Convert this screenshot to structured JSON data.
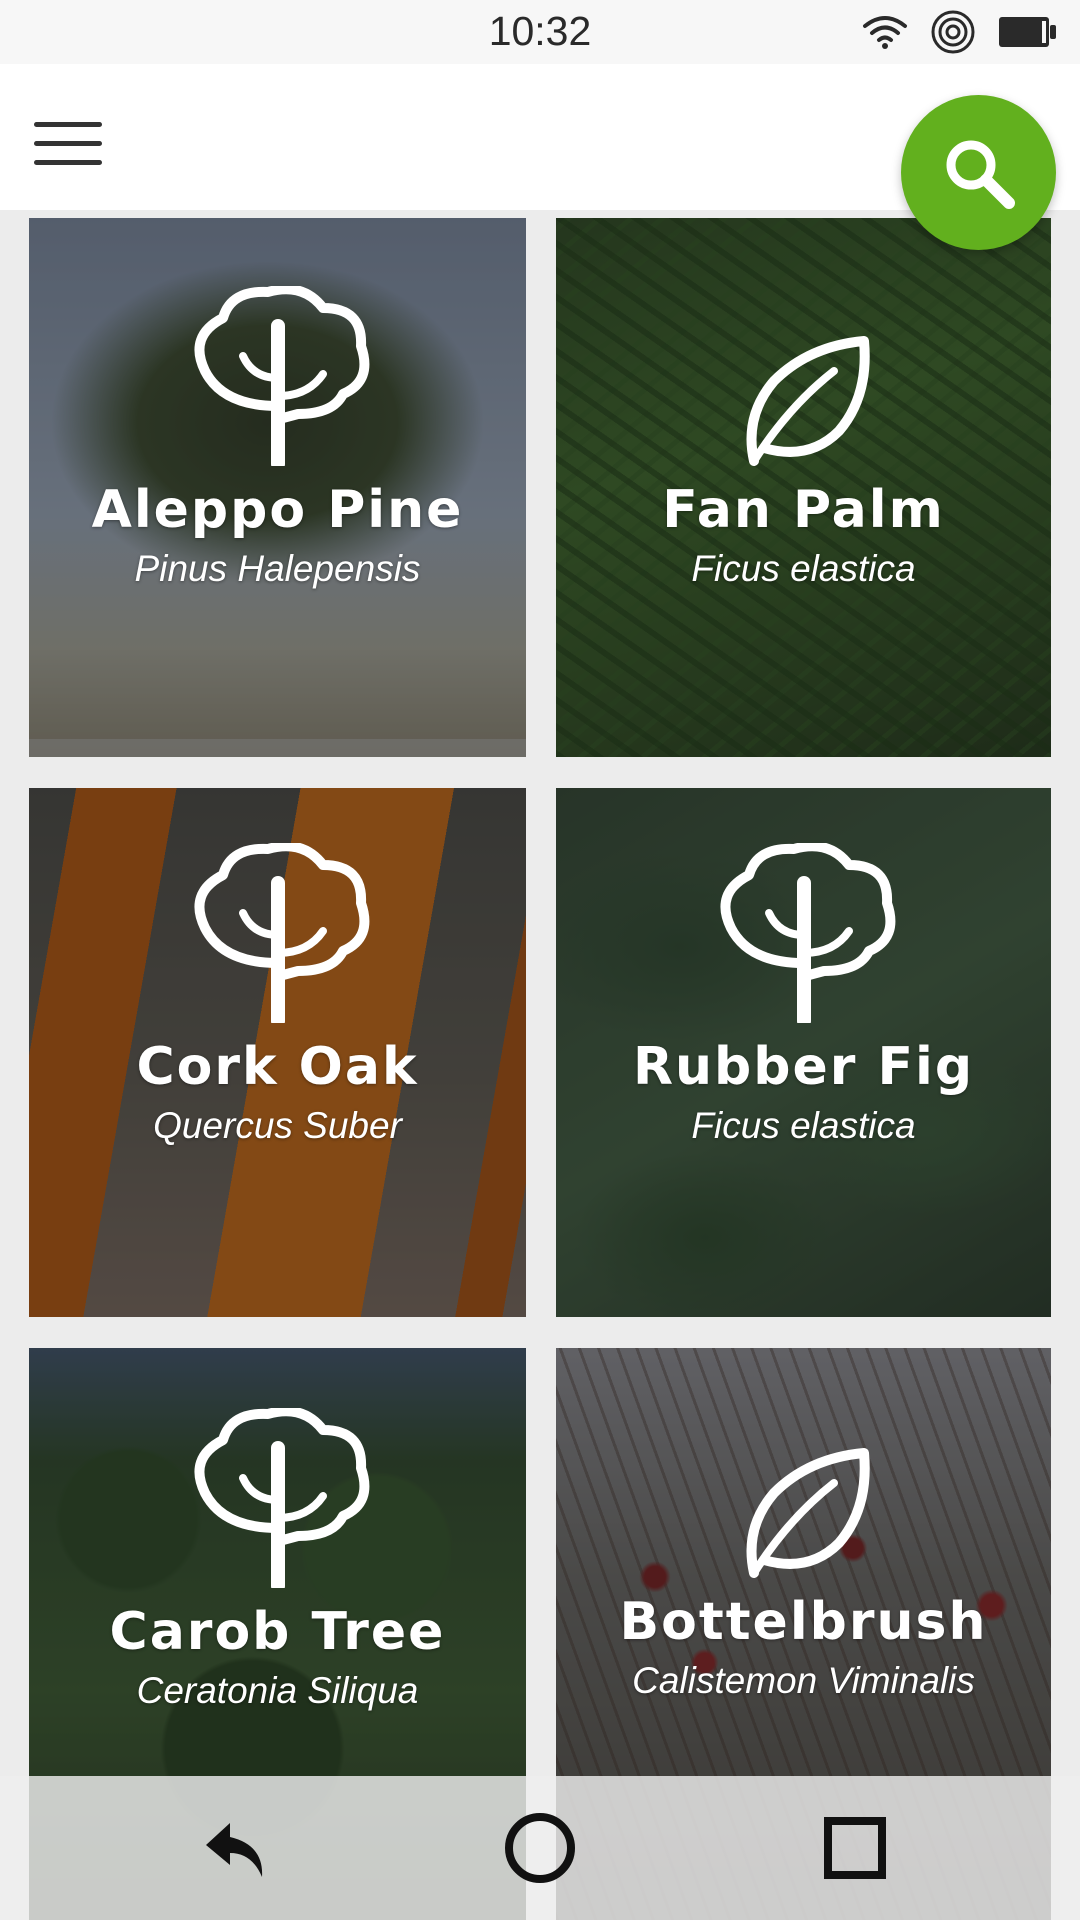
{
  "status_bar": {
    "time": "10:32",
    "icons": [
      "wifi-icon",
      "target-icon",
      "battery-icon"
    ]
  },
  "app_bar": {
    "menu_icon": "hamburger-menu-icon",
    "search_icon": "search-icon",
    "fab_color": "#62b01e"
  },
  "plants": [
    {
      "name": "Aleppo Pine",
      "latin": "Pinus Halepensis",
      "icon": "tree-icon"
    },
    {
      "name": "Fan Palm",
      "latin": "Ficus elastica",
      "icon": "leaf-icon"
    },
    {
      "name": "Cork Oak",
      "latin": "Quercus Suber",
      "icon": "tree-icon"
    },
    {
      "name": "Rubber Fig",
      "latin": "Ficus elastica",
      "icon": "tree-icon"
    },
    {
      "name": "Carob Tree",
      "latin": "Ceratonia Siliqua",
      "icon": "tree-icon"
    },
    {
      "name": "Bottelbrush",
      "latin": "Calistemon Viminalis",
      "icon": "leaf-icon"
    }
  ],
  "nav_bar": {
    "icons": [
      "back-icon",
      "home-icon",
      "recents-icon"
    ]
  }
}
